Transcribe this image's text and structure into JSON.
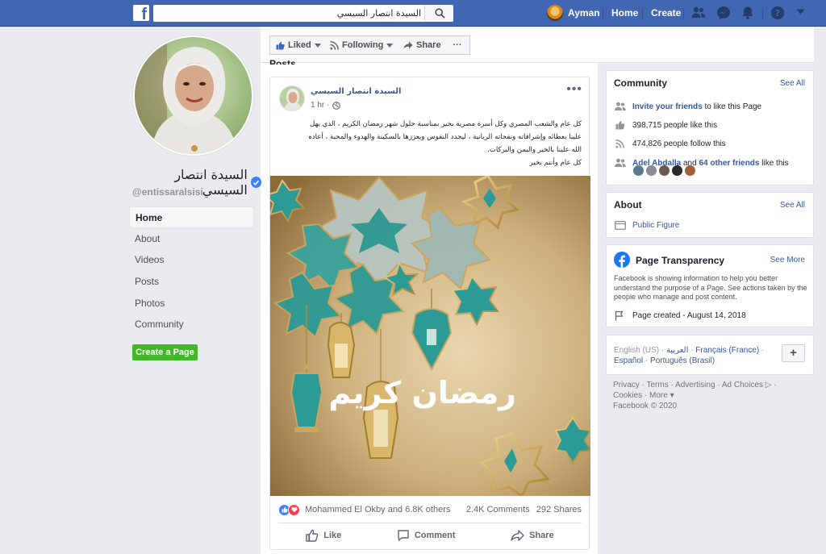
{
  "topbar": {
    "search_value": "السيدة انتصار السيسي",
    "profile_name": "Ayman",
    "home_label": "Home",
    "create_label": "Create"
  },
  "page": {
    "name": "السيدة انتصار السيسي",
    "handle": "@entissaralsisi"
  },
  "left_nav": {
    "items": [
      {
        "label": "Home"
      },
      {
        "label": "About"
      },
      {
        "label": "Videos"
      },
      {
        "label": "Posts"
      },
      {
        "label": "Photos"
      },
      {
        "label": "Community"
      }
    ],
    "create_page_label": "Create a Page"
  },
  "action_bar": {
    "liked_label": "Liked",
    "following_label": "Following",
    "share_label": "Share",
    "more_label": "···"
  },
  "posts_label": "Posts",
  "post": {
    "author": "السيدة انتصار السيسي",
    "time": "1 hr ·",
    "lines": [
      "كل عام والشعب المصري وكل أسرة مصرية بخير بمناسبة حلول شهر رمضان الكريم ، الذي يهل",
      "علينا بعطائه وإشراقاته ونفحاته الربانية ، ليجدد النفوس ويعززها بالسكينة والهدوء والمحبة ، أعاده",
      "الله علينا بالخير واليمن والبركات.",
      "كل عام وأنتم بخير"
    ],
    "image_text": "رمضان كريم",
    "reactions_text": "Mohammed El Okby and 6.8K others",
    "comments_text": "2.4K Comments",
    "shares_text": "292 Shares",
    "like_label": "Like",
    "comment_label": "Comment",
    "share_label": "Share"
  },
  "community": {
    "title": "Community",
    "see_all": "See All",
    "invite_link": "Invite your friends",
    "invite_rest": "to like this Page",
    "likes_text": "398,715 people like this",
    "follows_text": "474,826 people follow this",
    "friend_name": "Adel Abdalla",
    "friend_and": "and",
    "friend_others": "64 other friends",
    "friend_rest": "like this"
  },
  "about": {
    "title": "About",
    "see_all": "See All",
    "category": "Public Figure"
  },
  "transparency": {
    "title": "Page Transparency",
    "see_more": "See More",
    "description": "Facebook is showing information to help you better understand the purpose of a Page. See actions taken by the people who manage and post content.",
    "created": "Page created - August 14, 2018"
  },
  "languages": {
    "current": "English (US)",
    "arabic": "العربية",
    "french": "Français (France)",
    "spanish": "Español",
    "portuguese": "Português (Brasil)",
    "sep": "·",
    "plus": "+"
  },
  "footer": {
    "line1": "Privacy · Terms · Advertising · Ad Choices ▷ ·",
    "line2": "Cookies · More ▾",
    "copyright": "Facebook © 2020"
  },
  "colors": {
    "brand": "#4267b2",
    "link": "#385898",
    "create_green": "#42b72a"
  }
}
